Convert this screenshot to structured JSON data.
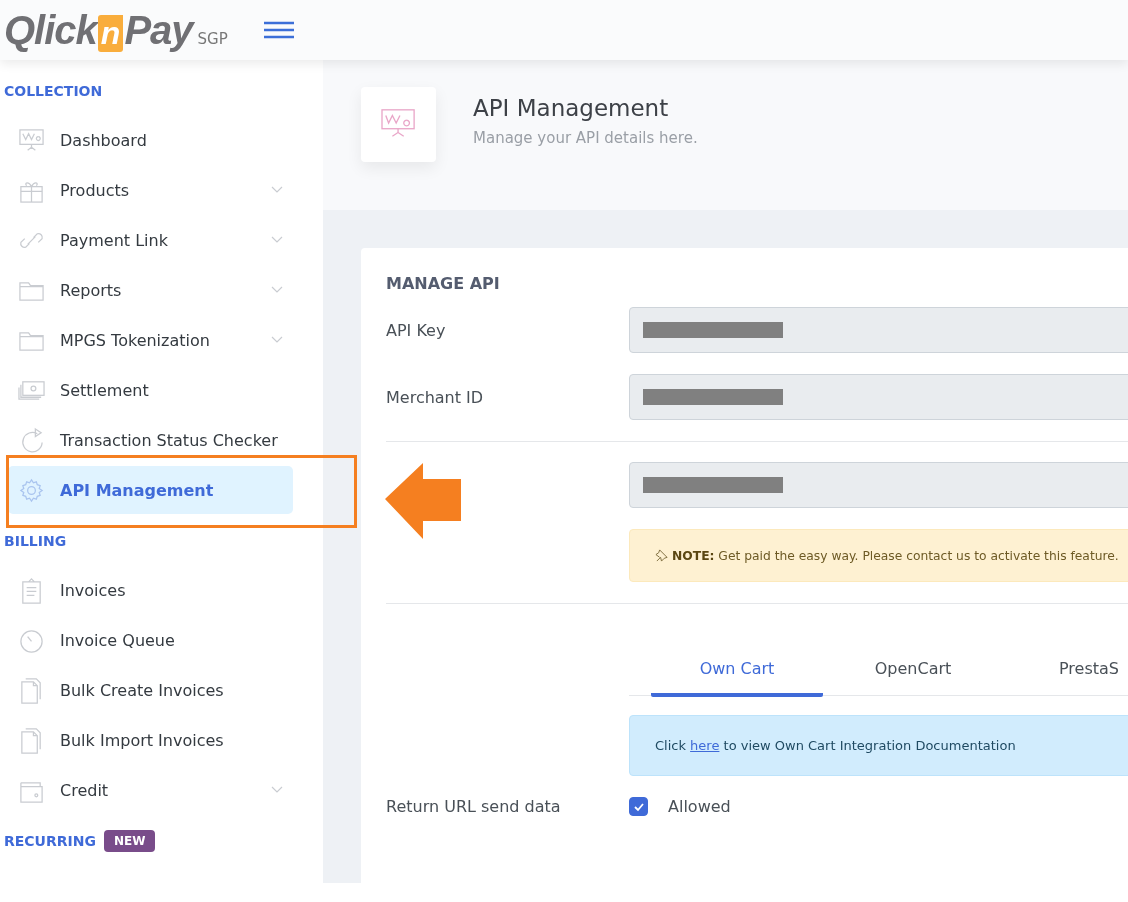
{
  "header": {
    "logo": {
      "first": "Qlick",
      "middle": "n",
      "last": "Pay",
      "region": "SGP"
    }
  },
  "sidebar": {
    "sections": [
      {
        "title": "COLLECTION",
        "items": [
          {
            "label": "Dashboard",
            "kind": "presentation",
            "expandable": false,
            "selected": false
          },
          {
            "label": "Products",
            "kind": "gift",
            "expandable": true,
            "selected": false
          },
          {
            "label": "Payment Link",
            "kind": "link",
            "expandable": true,
            "selected": false
          },
          {
            "label": "Reports",
            "kind": "folder",
            "expandable": true,
            "selected": false
          },
          {
            "label": "MPGS Tokenization",
            "kind": "folder",
            "expandable": true,
            "selected": false
          },
          {
            "label": "Settlement",
            "kind": "cash",
            "expandable": false,
            "selected": false
          },
          {
            "label": "Transaction Status Checker",
            "kind": "refresh",
            "expandable": false,
            "selected": false
          },
          {
            "label": "API Management",
            "kind": "gear",
            "expandable": false,
            "selected": true
          }
        ]
      },
      {
        "title": "BILLING",
        "items": [
          {
            "label": "Invoices",
            "kind": "clipboard",
            "expandable": false,
            "selected": false
          },
          {
            "label": "Invoice Queue",
            "kind": "timer",
            "expandable": false,
            "selected": false
          },
          {
            "label": "Bulk Create Invoices",
            "kind": "copy",
            "expandable": false,
            "selected": false
          },
          {
            "label": "Bulk Import Invoices",
            "kind": "copy",
            "expandable": false,
            "selected": false
          },
          {
            "label": "Credit",
            "kind": "wallet",
            "expandable": true,
            "selected": false
          }
        ]
      },
      {
        "title": "RECURRING",
        "badge": "NEW"
      }
    ]
  },
  "page_header": {
    "title": "API Management",
    "subtitle": "Manage your API details here."
  },
  "card": {
    "title": "MANAGE API",
    "fields": [
      {
        "label": "API Key",
        "redacted": true
      },
      {
        "label": "Merchant ID",
        "redacted": true
      },
      {
        "redacted": true
      }
    ],
    "note": {
      "label": "NOTE:",
      "text": "Get paid the easy way. Please contact us to activate this feature."
    },
    "tabs": [
      {
        "label": "Own Cart",
        "selected": true
      },
      {
        "label": "OpenCart",
        "selected": false
      },
      {
        "label": "PrestaS",
        "selected": false
      }
    ],
    "info": {
      "before": "Click",
      "link": "here",
      "after": "to view Own Cart Integration Documentation"
    },
    "return_url": {
      "label": "Return URL send data",
      "option": "Allowed",
      "checked": true
    }
  }
}
